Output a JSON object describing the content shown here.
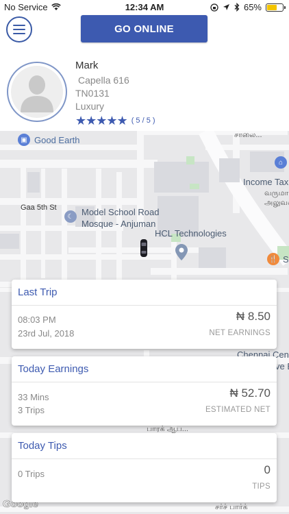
{
  "status_bar": {
    "carrier": "No Service",
    "time": "12:34 AM",
    "battery": "65%",
    "battery_level": 0.65
  },
  "header": {
    "go_online_label": "GO ONLINE"
  },
  "driver": {
    "name": "Mark",
    "car_model": "Capella 616",
    "plate": "TN0131",
    "category": "Luxury",
    "stars": "★★★★★",
    "rating_text": "( 5 / 5 )"
  },
  "map": {
    "labels": {
      "good_earth": "Good Earth",
      "saalai": "சாலை...",
      "income_tax": "Income Tax",
      "varumana": "வருமான",
      "aluvalagam": "அலுவல",
      "gaa5th": "Gaa 5th St",
      "mosque_line1": "Model School Road",
      "mosque_line2": "Mosque - Anjuman",
      "hcl": "HCL Technologies",
      "chennai1": "Chennai Cen",
      "chennai2": "ve B",
      "paark": "பாரக் ஆப...",
      "sarch": "சர்ச் பார்க்",
      "s_cut": "S"
    },
    "google": "Google"
  },
  "cards": {
    "last_trip": {
      "title": "Last Trip",
      "time": "08:03 PM",
      "date": "23rd Jul, 2018",
      "amount": "₦ 8.50",
      "caption": "NET EARNINGS"
    },
    "today_earnings": {
      "title": "Today Earnings",
      "duration": "33 Mins",
      "trips": "3 Trips",
      "amount": "₦ 52.70",
      "caption": "ESTIMATED NET"
    },
    "today_tips": {
      "title": "Today Tips",
      "trips": "0 Trips",
      "amount": "0",
      "caption": "TIPS"
    }
  }
}
